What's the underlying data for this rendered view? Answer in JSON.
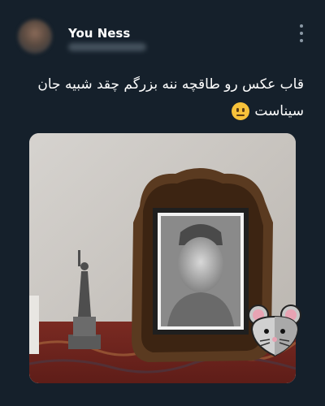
{
  "tweet": {
    "author_name": "You Ness",
    "text_line1": "قاب عکس رو طاقچه ننه بزرگم چقد شبیه جان",
    "text_line2": "سیناست",
    "emoji": "neutral-face-emoji"
  },
  "icons": {
    "more": "more-vertical-icon",
    "sticker": "mouse-icon"
  },
  "colors": {
    "background": "#15202b",
    "text": "#ffffff",
    "muted": "#8b98a5",
    "frame": "#5a3a20",
    "rug": "#8a2a22"
  }
}
